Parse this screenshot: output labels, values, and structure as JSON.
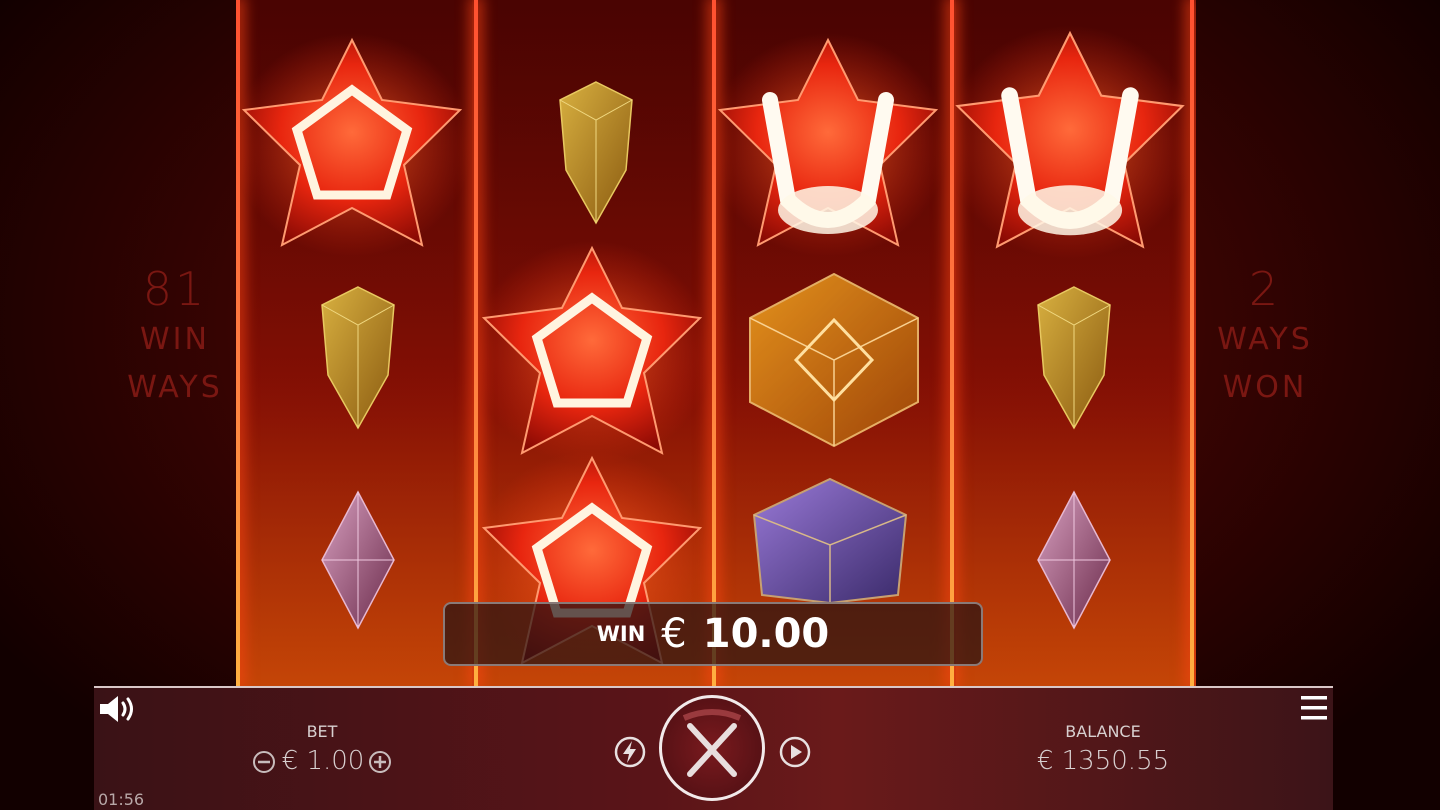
{
  "left_panel": {
    "count": "81",
    "line1": "WIN",
    "line2": "WAYS"
  },
  "right_panel": {
    "count": "2",
    "line1": "WAYS",
    "line2": "WON"
  },
  "win_display": {
    "label": "WIN",
    "currency": "€",
    "amount": "10.00"
  },
  "bet": {
    "label": "BET",
    "value": "€ 1.00"
  },
  "balance": {
    "label": "BALANCE",
    "value": "€ 1350.55"
  },
  "clock": "01:56",
  "icons": {
    "sound": "speaker-icon",
    "bet_decrease": "minus-circle-icon",
    "bet_increase": "plus-circle-icon",
    "quick_spin": "lightning-icon",
    "spin_stop": "x-icon",
    "autoplay": "play-icon",
    "menu": "hamburger-menu-icon"
  },
  "colors": {
    "side_text": "#7a1712",
    "divider_glow": "#ff5030",
    "star_gem": "#e8260f",
    "amber_gem": "#b48a1e",
    "pink_gem": "#a86a8a",
    "purple_gem": "#6a4aa8"
  },
  "reels": [
    [
      "red-star-gem-winning",
      "amber-drop-gem",
      "pink-diamond-gem"
    ],
    [
      "amber-drop-gem",
      "red-star-gem-winning",
      "red-star-gem-winning"
    ],
    [
      "red-star-gem-winning",
      "orange-polyhedron-gem",
      "purple-polyhedron-gem"
    ],
    [
      "red-star-gem-winning",
      "amber-drop-gem",
      "pink-diamond-gem"
    ]
  ]
}
